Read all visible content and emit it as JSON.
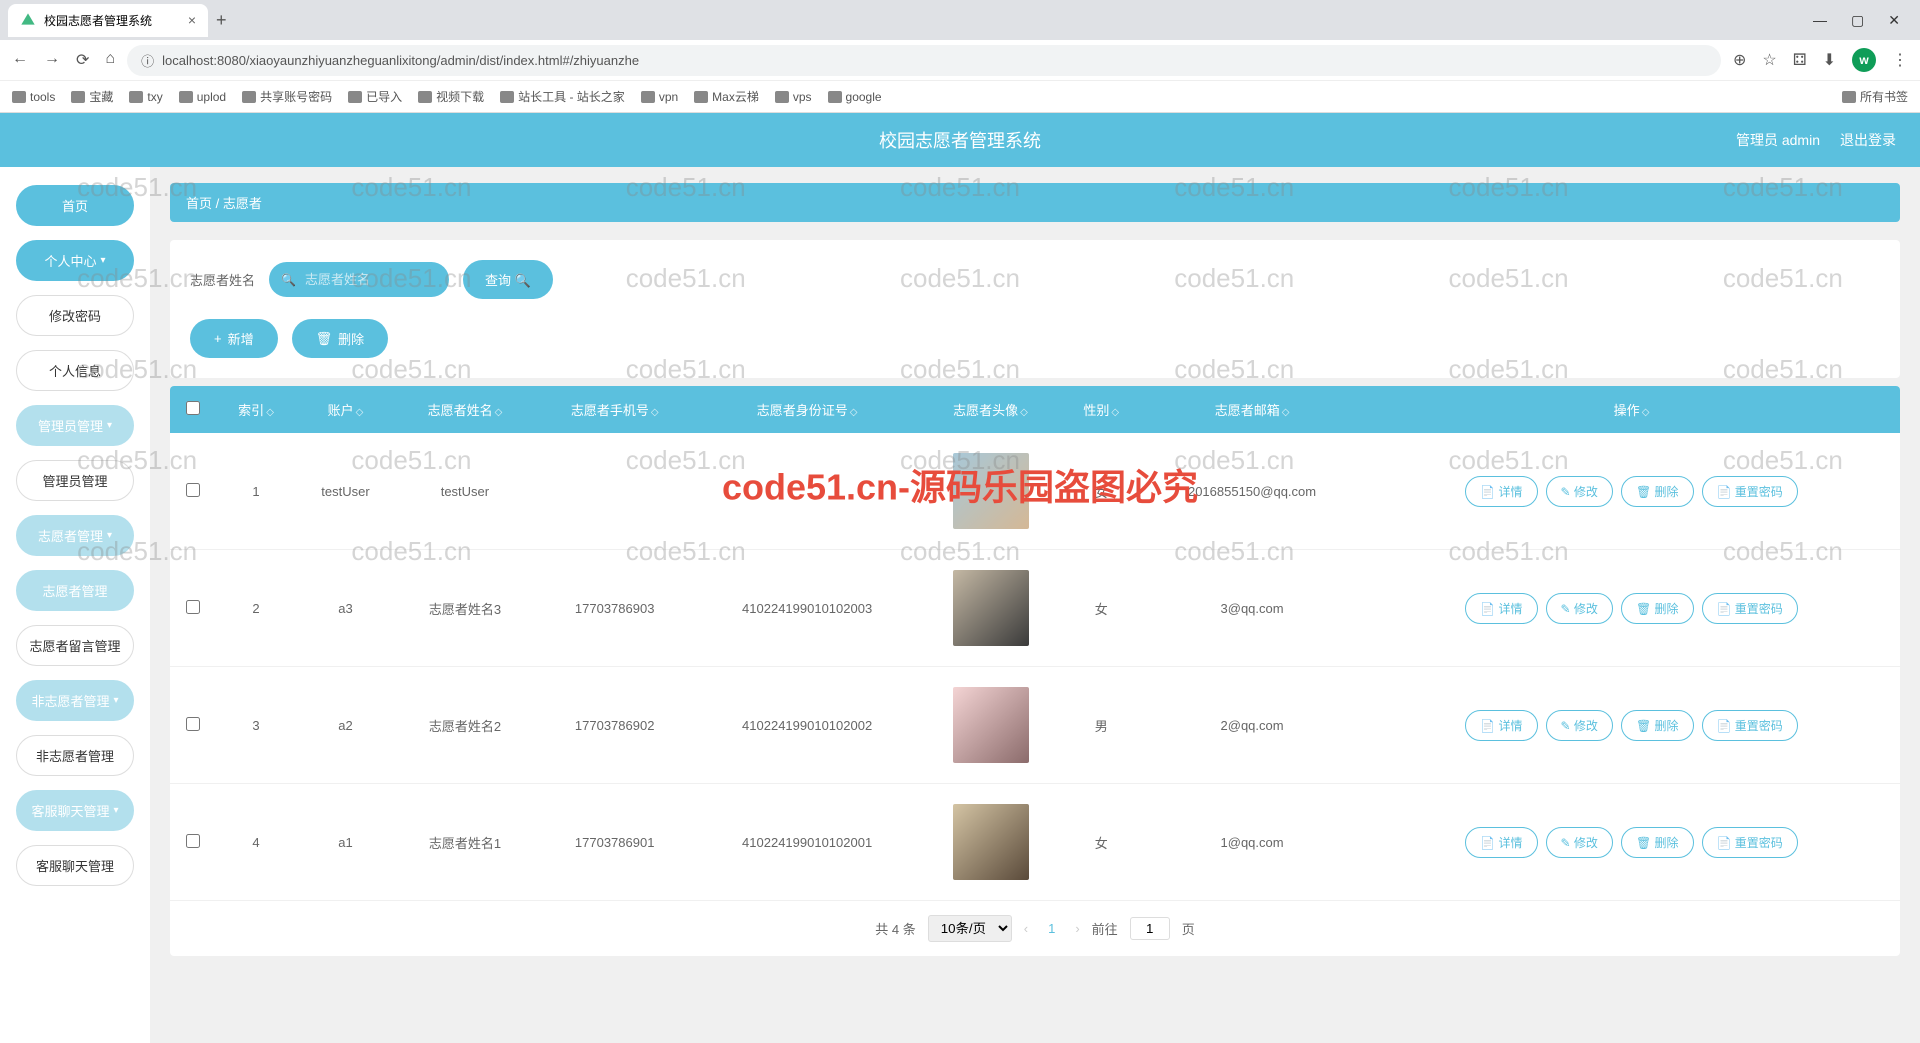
{
  "browser": {
    "tab_title": "校园志愿者管理系统",
    "url": "localhost:8080/xiaoyaunzhiyuanzheguanlixitong/admin/dist/index.html#/zhiyuanzhe",
    "bookmarks": [
      "tools",
      "宝藏",
      "txy",
      "uplod",
      "共享账号密码",
      "已导入",
      "视频下载",
      "站长工具 - 站长之家",
      "vpn",
      "Max云梯",
      "vps",
      "google"
    ],
    "all_bookmarks": "所有书签"
  },
  "header": {
    "title": "校园志愿者管理系统",
    "admin_label": "管理员 admin",
    "logout": "退出登录"
  },
  "sidebar": {
    "items": [
      {
        "label": "首页",
        "style": "primary"
      },
      {
        "label": "个人中心",
        "style": "primary",
        "expandable": true
      },
      {
        "label": "修改密码",
        "style": "white"
      },
      {
        "label": "个人信息",
        "style": "white"
      },
      {
        "label": "管理员管理",
        "style": "light",
        "expandable": true
      },
      {
        "label": "管理员管理",
        "style": "white"
      },
      {
        "label": "志愿者管理",
        "style": "light",
        "expandable": true
      },
      {
        "label": "志愿者管理",
        "style": "light"
      },
      {
        "label": "志愿者留言管理",
        "style": "white"
      },
      {
        "label": "非志愿者管理",
        "style": "light",
        "expandable": true
      },
      {
        "label": "非志愿者管理",
        "style": "white"
      },
      {
        "label": "客服聊天管理",
        "style": "light",
        "expandable": true
      },
      {
        "label": "客服聊天管理",
        "style": "white"
      }
    ]
  },
  "breadcrumb": {
    "home": "首页",
    "sep": "/",
    "current": "志愿者"
  },
  "search": {
    "label": "志愿者姓名",
    "placeholder": "志愿者姓名",
    "query_btn": "查询"
  },
  "actions": {
    "add": "新增",
    "delete": "删除"
  },
  "table": {
    "headers": [
      "索引",
      "账户",
      "志愿者姓名",
      "志愿者手机号",
      "志愿者身份证号",
      "志愿者头像",
      "性别",
      "志愿者邮箱",
      "操作"
    ],
    "rows": [
      {
        "idx": "1",
        "account": "testUser",
        "name": "testUser",
        "phone": "",
        "idcard": "",
        "avatar": "a1",
        "gender": "女",
        "email": "2016855150@qq.com"
      },
      {
        "idx": "2",
        "account": "a3",
        "name": "志愿者姓名3",
        "phone": "17703786903",
        "idcard": "410224199010102003",
        "avatar": "a2",
        "gender": "女",
        "email": "3@qq.com"
      },
      {
        "idx": "3",
        "account": "a2",
        "name": "志愿者姓名2",
        "phone": "17703786902",
        "idcard": "410224199010102002",
        "avatar": "a3",
        "gender": "男",
        "email": "2@qq.com"
      },
      {
        "idx": "4",
        "account": "a1",
        "name": "志愿者姓名1",
        "phone": "17703786901",
        "idcard": "410224199010102001",
        "avatar": "a4",
        "gender": "女",
        "email": "1@qq.com"
      }
    ],
    "ops": {
      "detail": "详情",
      "edit": "修改",
      "delete": "删除",
      "reset": "重置密码"
    }
  },
  "pagination": {
    "total": "共 4 条",
    "page_size": "10条/页",
    "current": "1",
    "goto": "前往",
    "goto_val": "1",
    "page_suffix": "页"
  },
  "watermark": {
    "text": "code51.cn",
    "center": "code51.cn-源码乐园盗图必究"
  }
}
